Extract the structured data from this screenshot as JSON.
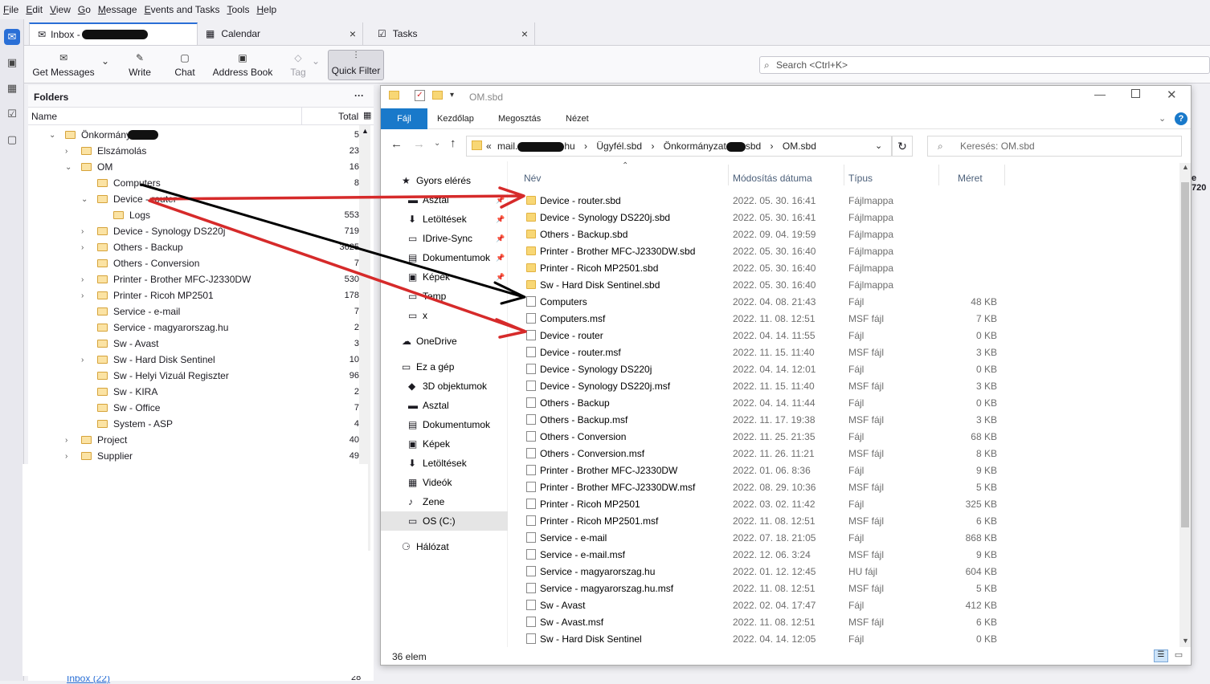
{
  "menu": [
    "File",
    "Edit",
    "View",
    "Go",
    "Message",
    "Events and Tasks",
    "Tools",
    "Help"
  ],
  "tabs": [
    {
      "label": "Inbox - "
    },
    {
      "label": "Calendar",
      "close": "×"
    },
    {
      "label": "Tasks",
      "close": "×"
    }
  ],
  "toolbar": {
    "get_messages": "Get Messages",
    "write": "Write",
    "chat": "Chat",
    "address_book": "Address Book",
    "tag": "Tag",
    "quick_filter": "Quick Filter",
    "search_placeholder": "Search <Ctrl+K>"
  },
  "folder_pane": {
    "title": "Folders",
    "col_name": "Name",
    "col_total": "Total",
    "folders": [
      {
        "label": "Önkormányz",
        "total": "5",
        "indent": 0,
        "twisty": "expanded"
      },
      {
        "label": "Elszámolás",
        "total": "23",
        "indent": 1,
        "twisty": "collapsed"
      },
      {
        "label": "OM",
        "total": "16",
        "indent": 1,
        "twisty": "expanded"
      },
      {
        "label": "Computers",
        "total": "8",
        "indent": 2,
        "twisty": ""
      },
      {
        "label": "Device - router",
        "total": "",
        "indent": 2,
        "twisty": "expanded"
      },
      {
        "label": "Logs",
        "total": "553",
        "indent": 3,
        "twisty": ""
      },
      {
        "label": "Device - Synology DS220j",
        "total": "719",
        "indent": 2,
        "twisty": "collapsed"
      },
      {
        "label": "Others - Backup",
        "total": "3625",
        "indent": 2,
        "twisty": "collapsed"
      },
      {
        "label": "Others - Conversion",
        "total": "7",
        "indent": 2,
        "twisty": ""
      },
      {
        "label": "Printer - Brother MFC-J2330DW",
        "total": "530",
        "indent": 2,
        "twisty": "collapsed"
      },
      {
        "label": "Printer - Ricoh MP2501",
        "total": "178",
        "indent": 2,
        "twisty": "collapsed"
      },
      {
        "label": "Service - e-mail",
        "total": "7",
        "indent": 2,
        "twisty": ""
      },
      {
        "label": "Service - magyarorszag.hu",
        "total": "2",
        "indent": 2,
        "twisty": ""
      },
      {
        "label": "Sw - Avast",
        "total": "3",
        "indent": 2,
        "twisty": ""
      },
      {
        "label": "Sw - Hard Disk Sentinel",
        "total": "10",
        "indent": 2,
        "twisty": "collapsed"
      },
      {
        "label": "Sw - Helyi Vizuál Regiszter",
        "total": "96",
        "indent": 2,
        "twisty": ""
      },
      {
        "label": "Sw - KIRA",
        "total": "2",
        "indent": 2,
        "twisty": ""
      },
      {
        "label": "Sw - Office",
        "total": "7",
        "indent": 2,
        "twisty": ""
      },
      {
        "label": "System - ASP",
        "total": "4",
        "indent": 2,
        "twisty": ""
      },
      {
        "label": "Project",
        "total": "40",
        "indent": 1,
        "twisty": "collapsed"
      },
      {
        "label": "Supplier",
        "total": "49",
        "indent": 1,
        "twisty": "collapsed"
      }
    ],
    "bottom_folder": "Inbox (22)",
    "bottom_total": "28"
  },
  "explorer": {
    "title": "OM.sbd",
    "ribbon": [
      "Fájl",
      "Kezdőlap",
      "Megosztás",
      "Nézet"
    ],
    "address": [
      "mail.",
      "hu",
      "Ügyfél.sbd",
      "Önkormányzat",
      "sbd",
      "OM.sbd"
    ],
    "search_placeholder": "Keresés: OM.sbd",
    "nav": [
      {
        "label": "Gyors elérés",
        "icon": "★",
        "pinned": false,
        "indent": 0
      },
      {
        "label": "Asztal",
        "icon": "▬",
        "pinned": true,
        "indent": 1
      },
      {
        "label": "Letöltések",
        "icon": "⬇",
        "pinned": true,
        "indent": 1
      },
      {
        "label": "IDrive-Sync",
        "icon": "▭",
        "pinned": true,
        "indent": 1
      },
      {
        "label": "Dokumentumok",
        "icon": "▤",
        "pinned": true,
        "indent": 1
      },
      {
        "label": "Képek",
        "icon": "▣",
        "pinned": true,
        "indent": 1
      },
      {
        "label": "Temp",
        "icon": "▭",
        "pinned": false,
        "indent": 1
      },
      {
        "label": "x",
        "icon": "▭",
        "pinned": false,
        "indent": 1
      },
      {
        "label": "OneDrive",
        "icon": "☁",
        "pinned": false,
        "indent": 0
      },
      {
        "label": "Ez a gép",
        "icon": "▭",
        "pinned": false,
        "indent": 0
      },
      {
        "label": "3D objektumok",
        "icon": "◆",
        "pinned": false,
        "indent": 1
      },
      {
        "label": "Asztal",
        "icon": "▬",
        "pinned": false,
        "indent": 1
      },
      {
        "label": "Dokumentumok",
        "icon": "▤",
        "pinned": false,
        "indent": 1
      },
      {
        "label": "Képek",
        "icon": "▣",
        "pinned": false,
        "indent": 1
      },
      {
        "label": "Letöltések",
        "icon": "⬇",
        "pinned": false,
        "indent": 1
      },
      {
        "label": "Videók",
        "icon": "▦",
        "pinned": false,
        "indent": 1
      },
      {
        "label": "Zene",
        "icon": "♪",
        "pinned": false,
        "indent": 1
      },
      {
        "label": "OS (C:)",
        "icon": "▭",
        "pinned": false,
        "indent": 1,
        "selected": true
      },
      {
        "label": "Hálózat",
        "icon": "⚆",
        "pinned": false,
        "indent": 0
      }
    ],
    "columns": [
      "Név",
      "Módosítás dátuma",
      "Típus",
      "Méret"
    ],
    "files": [
      {
        "name": "Device - router.sbd",
        "date": "2022. 05. 30. 16:41",
        "type": "Fájlmappa",
        "size": "",
        "folder": true
      },
      {
        "name": "Device - Synology DS220j.sbd",
        "date": "2022. 05. 30. 16:41",
        "type": "Fájlmappa",
        "size": "",
        "folder": true
      },
      {
        "name": "Others - Backup.sbd",
        "date": "2022. 09. 04. 19:59",
        "type": "Fájlmappa",
        "size": "",
        "folder": true
      },
      {
        "name": "Printer - Brother MFC-J2330DW.sbd",
        "date": "2022. 05. 30. 16:40",
        "type": "Fájlmappa",
        "size": "",
        "folder": true
      },
      {
        "name": "Printer - Ricoh MP2501.sbd",
        "date": "2022. 05. 30. 16:40",
        "type": "Fájlmappa",
        "size": "",
        "folder": true
      },
      {
        "name": "Sw - Hard Disk Sentinel.sbd",
        "date": "2022. 05. 30. 16:40",
        "type": "Fájlmappa",
        "size": "",
        "folder": true
      },
      {
        "name": "Computers",
        "date": "2022. 04. 08. 21:43",
        "type": "Fájl",
        "size": "48 KB",
        "folder": false
      },
      {
        "name": "Computers.msf",
        "date": "2022. 11. 08. 12:51",
        "type": "MSF fájl",
        "size": "7 KB",
        "folder": false
      },
      {
        "name": "Device - router",
        "date": "2022. 04. 14. 11:55",
        "type": "Fájl",
        "size": "0 KB",
        "folder": false
      },
      {
        "name": "Device - router.msf",
        "date": "2022. 11. 15. 11:40",
        "type": "MSF fájl",
        "size": "3 KB",
        "folder": false
      },
      {
        "name": "Device - Synology DS220j",
        "date": "2022. 04. 14. 12:01",
        "type": "Fájl",
        "size": "0 KB",
        "folder": false
      },
      {
        "name": "Device - Synology DS220j.msf",
        "date": "2022. 11. 15. 11:40",
        "type": "MSF fájl",
        "size": "3 KB",
        "folder": false
      },
      {
        "name": "Others - Backup",
        "date": "2022. 04. 14. 11:44",
        "type": "Fájl",
        "size": "0 KB",
        "folder": false
      },
      {
        "name": "Others - Backup.msf",
        "date": "2022. 11. 17. 19:38",
        "type": "MSF fájl",
        "size": "3 KB",
        "folder": false
      },
      {
        "name": "Others - Conversion",
        "date": "2022. 11. 25. 21:35",
        "type": "Fájl",
        "size": "68 KB",
        "folder": false
      },
      {
        "name": "Others - Conversion.msf",
        "date": "2022. 11. 26. 11:21",
        "type": "MSF fájl",
        "size": "8 KB",
        "folder": false
      },
      {
        "name": "Printer - Brother MFC-J2330DW",
        "date": "2022. 01. 06. 8:36",
        "type": "Fájl",
        "size": "9 KB",
        "folder": false
      },
      {
        "name": "Printer - Brother MFC-J2330DW.msf",
        "date": "2022. 08. 29. 10:36",
        "type": "MSF fájl",
        "size": "5 KB",
        "folder": false
      },
      {
        "name": "Printer - Ricoh MP2501",
        "date": "2022. 03. 02. 11:42",
        "type": "Fájl",
        "size": "325 KB",
        "folder": false
      },
      {
        "name": "Printer - Ricoh MP2501.msf",
        "date": "2022. 11. 08. 12:51",
        "type": "MSF fájl",
        "size": "6 KB",
        "folder": false
      },
      {
        "name": "Service - e-mail",
        "date": "2022. 07. 18. 21:05",
        "type": "Fájl",
        "size": "868 KB",
        "folder": false
      },
      {
        "name": "Service - e-mail.msf",
        "date": "2022. 12. 06. 3:24",
        "type": "MSF fájl",
        "size": "9 KB",
        "folder": false
      },
      {
        "name": "Service - magyarorszag.hu",
        "date": "2022. 01. 12. 12:45",
        "type": "HU fájl",
        "size": "604 KB",
        "folder": false
      },
      {
        "name": "Service - magyarorszag.hu.msf",
        "date": "2022. 11. 08. 12:51",
        "type": "MSF fájl",
        "size": "5 KB",
        "folder": false
      },
      {
        "name": "Sw - Avast",
        "date": "2022. 02. 04. 17:47",
        "type": "Fájl",
        "size": "412 KB",
        "folder": false
      },
      {
        "name": "Sw - Avast.msf",
        "date": "2022. 11. 08. 12:51",
        "type": "MSF fájl",
        "size": "6 KB",
        "folder": false
      },
      {
        "name": "Sw - Hard Disk Sentinel",
        "date": "2022. 04. 14. 12:05",
        "type": "Fájl",
        "size": "0 KB",
        "folder": false
      }
    ],
    "status": "36 elem"
  },
  "partial_text_right": "e 720",
  "colors": {
    "accent": "#2a6fd6",
    "arrow_red": "#d62a2a",
    "arrow_black": "#000000",
    "ribbon_file": "#1979ca"
  }
}
